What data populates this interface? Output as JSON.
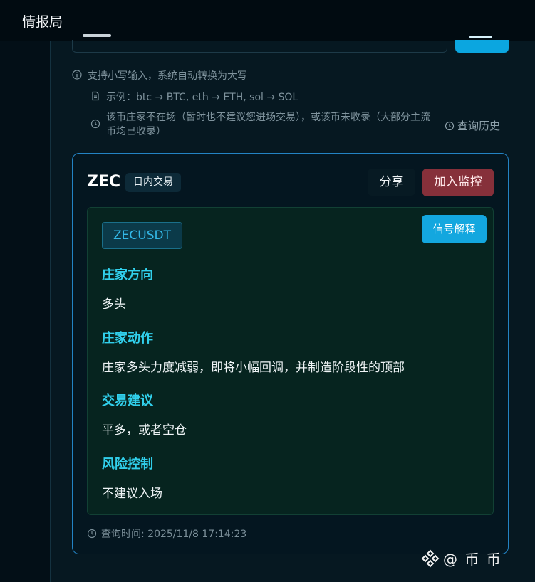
{
  "app": {
    "title": "情报局"
  },
  "hints": {
    "lowercase": "支持小写输入，系统自动转换为大写",
    "example": "示例：btc → BTC, eth → ETH, sol → SOL",
    "not_found": "该币庄家不在场（暂时也不建议您进场交易），或该币未收录（大部分主流币均已收录）",
    "history_link": "查询历史"
  },
  "result": {
    "symbol": "ZEC",
    "tag": "日内交易",
    "share_label": "分享",
    "monitor_label": "加入监控",
    "pair": "ZECUSDT",
    "explain_label": "信号解释",
    "sections": [
      {
        "title": "庄家方向",
        "text": "多头"
      },
      {
        "title": "庄家动作",
        "text": "庄家多头力度减弱，即将小幅回调，并制造阶段性的顶部"
      },
      {
        "title": "交易建议",
        "text": "平多，或者空仓"
      },
      {
        "title": "风险控制",
        "text": "不建议入场"
      }
    ],
    "query_time": "查询时间: 2025/11/8 17:14:23"
  },
  "watermark": {
    "text": "@ 币  币"
  },
  "colors": {
    "accent": "#13a7df",
    "section_title": "#31d0ec",
    "danger": "#86303a",
    "card_border": "#2383c4"
  }
}
